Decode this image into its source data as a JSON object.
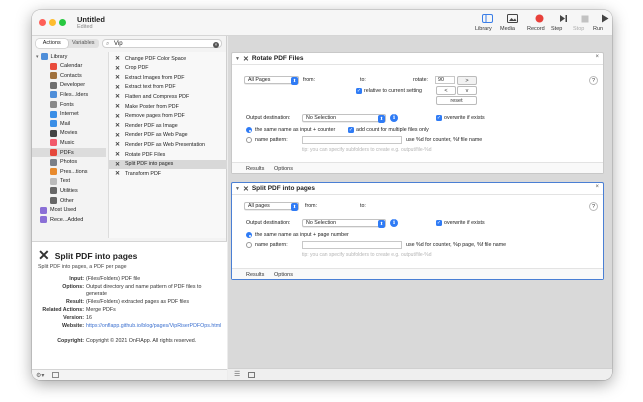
{
  "window": {
    "title": "Untitled",
    "subtitle": "Edited"
  },
  "toolbar": {
    "library": "Library",
    "media": "Media",
    "record": "Record",
    "step": "Step",
    "stop": "Stop",
    "run": "Run"
  },
  "segment": {
    "actions": "Actions",
    "variables": "Variables"
  },
  "search": {
    "value": "Vip"
  },
  "library": [
    {
      "label": "Library",
      "icon": "library-icon",
      "color": "#4e8ed9"
    },
    {
      "label": "Calendar",
      "icon": "calendar-icon",
      "color": "#e94b3c"
    },
    {
      "label": "Contacts",
      "icon": "contacts-icon",
      "color": "#a0713d"
    },
    {
      "label": "Developer",
      "icon": "developer-icon",
      "color": "#6d6d6d"
    },
    {
      "label": "Files...lders",
      "icon": "files-icon",
      "color": "#4e8ed9"
    },
    {
      "label": "Fonts",
      "icon": "fonts-icon",
      "color": "#888888"
    },
    {
      "label": "Internet",
      "icon": "internet-icon",
      "color": "#3a8ee6"
    },
    {
      "label": "Mail",
      "icon": "mail-icon",
      "color": "#3a8ee6"
    },
    {
      "label": "Movies",
      "icon": "movies-icon",
      "color": "#444444"
    },
    {
      "label": "Music",
      "icon": "music-icon",
      "color": "#f25a6b"
    },
    {
      "label": "PDFs",
      "icon": "pdfs-icon",
      "color": "#e5483c"
    },
    {
      "label": "Photos",
      "icon": "photos-icon",
      "color": "#7b8088"
    },
    {
      "label": "Pres...tions",
      "icon": "presentations-icon",
      "color": "#e88a2d"
    },
    {
      "label": "Text",
      "icon": "text-icon",
      "color": "#bbbbbb"
    },
    {
      "label": "Utilities",
      "icon": "utilities-icon",
      "color": "#666666"
    },
    {
      "label": "Other",
      "icon": "other-icon",
      "color": "#666666"
    },
    {
      "label": "Most Used",
      "icon": "most-used-icon",
      "color": "#8a6fd6"
    },
    {
      "label": "Rece...Added",
      "icon": "recently-added-icon",
      "color": "#8a6fd6"
    }
  ],
  "actions": [
    "Change PDF Color Space",
    "Crop PDF",
    "Extract Images from PDF",
    "Extract text from PDF",
    "Flatten and Compress PDF",
    "Make Poster from PDF",
    "Remove pages from PDF",
    "Render PDF as Image",
    "Render PDF as Web Page",
    "Render PDF as Web Presentation",
    "Rotate PDF Files",
    "Split PDF into pages",
    "Transform PDF"
  ],
  "description": {
    "title": "Split PDF into pages",
    "subtitle": "Split PDF into pages, a PDF per page",
    "input_k": "Input:",
    "input_v": "(Files/Folders) PDF file",
    "options_k": "Options:",
    "options_v": "Output directory and name pattern of PDF files to generate",
    "result_k": "Result:",
    "result_v": "(Files/Folders) extracted pages as PDF files",
    "related_k": "Related Actions:",
    "related_v": "Merge PDFs",
    "version_k": "Version:",
    "version_v": "16",
    "website_k": "Website:",
    "website_v": "https://onflapp.github.io/blog/pages/VipRiserPDFOps.html",
    "copyright_k": "Copyright:",
    "copyright_v": "Copyright © 2021 OnFlApp. All rights reserved."
  },
  "rotate": {
    "title": "Rotate PDF Files",
    "pages": "All Pages",
    "from": "from:",
    "to": "to:",
    "rotate_label": "rotate:",
    "rotate_value": "90",
    "relative": "relative to current setting",
    "reset": "reset",
    "dest_label": "Output destination:",
    "dest_value": "No Selection",
    "overwrite": "overwrite if exists",
    "same_name": "the same name as input + counter",
    "add_count": "add count for multiple files only",
    "name_pattern": "name pattern:",
    "use_counter": "use %d for counter, %f file name",
    "hint": "tip: you can specify subfolders to create e.g. output/file-%d",
    "results": "Results",
    "options": "Options"
  },
  "split": {
    "title": "Split PDF into pages",
    "pages": "All pages",
    "from": "from:",
    "to": "to:",
    "dest_label": "Output destination:",
    "dest_value": "No Selection",
    "overwrite": "overwrite if exists",
    "same_name": "the same name as input + page number",
    "name_pattern": "name pattern:",
    "use_counter": "use %d for counter, %p page, %f file name",
    "hint": "tip: you can specify subfolders to create e.g. output/file-%d",
    "results": "Results",
    "options": "Options"
  }
}
